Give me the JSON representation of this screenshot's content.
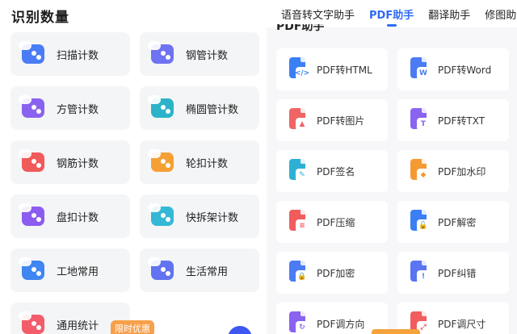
{
  "left_panel": {
    "title": "识别数量",
    "items": [
      {
        "label": "扫描计数",
        "icon": "scan-count-icon",
        "color": "#4a7df5"
      },
      {
        "label": "钢管计数",
        "icon": "steel-pipe-count-icon",
        "color": "#6d73f2"
      },
      {
        "label": "方管计数",
        "icon": "square-pipe-count-icon",
        "color": "#8a62f0"
      },
      {
        "label": "椭圆管计数",
        "icon": "oval-pipe-count-icon",
        "color": "#2cb3c9"
      },
      {
        "label": "钢筋计数",
        "icon": "rebar-count-icon",
        "color": "#f15a5a"
      },
      {
        "label": "轮扣计数",
        "icon": "wheel-buckle-count-icon",
        "color": "#f5a033"
      },
      {
        "label": "盘扣计数",
        "icon": "disc-buckle-count-icon",
        "color": "#8b5cf0"
      },
      {
        "label": "快拆架计数",
        "icon": "quick-frame-count-icon",
        "color": "#35b8d6"
      },
      {
        "label": "工地常用",
        "icon": "construction-site-icon",
        "color": "#3f86f2"
      },
      {
        "label": "生活常用",
        "icon": "daily-life-icon",
        "color": "#6173f0"
      },
      {
        "label": "通用统计",
        "icon": "general-stats-icon",
        "color": "#f35d6b"
      }
    ],
    "promo_badge": "限时优惠"
  },
  "right_panel": {
    "tabs": [
      {
        "label": "语音转文字助手",
        "active": false
      },
      {
        "label": "PDF助手",
        "active": true
      },
      {
        "label": "翻译助手",
        "active": false
      },
      {
        "label": "修图助手",
        "active": false
      }
    ],
    "section_title_peek": "PDF助手",
    "tools": [
      {
        "label": "PDF转HTML",
        "icon": "pdf-to-html-icon",
        "color": "#3a7ff4",
        "badge": "</>"
      },
      {
        "label": "PDF转Word",
        "icon": "pdf-to-word-icon",
        "color": "#4b7cf4",
        "badge": "W"
      },
      {
        "label": "PDF转图片",
        "icon": "pdf-to-image-icon",
        "color": "#f06464",
        "badge": "▲"
      },
      {
        "label": "PDF转TXT",
        "icon": "pdf-to-txt-icon",
        "color": "#8a63f0",
        "badge": "T"
      },
      {
        "label": "PDF签名",
        "icon": "pdf-sign-icon",
        "color": "#2db0d3",
        "badge": "✎"
      },
      {
        "label": "PDF加水印",
        "icon": "pdf-watermark-icon",
        "color": "#f59a33",
        "badge": "◆"
      },
      {
        "label": "PDF压缩",
        "icon": "pdf-compress-icon",
        "color": "#f15c5c",
        "badge": "≡"
      },
      {
        "label": "PDF解密",
        "icon": "pdf-decrypt-icon",
        "color": "#3a7ff4",
        "badge": "🔓"
      },
      {
        "label": "PDF加密",
        "icon": "pdf-encrypt-icon",
        "color": "#4b7cf4",
        "badge": "🔒"
      },
      {
        "label": "PDF纠错",
        "icon": "pdf-correct-icon",
        "color": "#5a74f2",
        "badge": "!"
      },
      {
        "label": "PDF调方向",
        "icon": "pdf-rotate-icon",
        "color": "#8a63f0",
        "badge": "↻"
      },
      {
        "label": "PDF调尺寸",
        "icon": "pdf-resize-icon",
        "color": "#f15c5c",
        "badge": "⤢"
      }
    ]
  }
}
